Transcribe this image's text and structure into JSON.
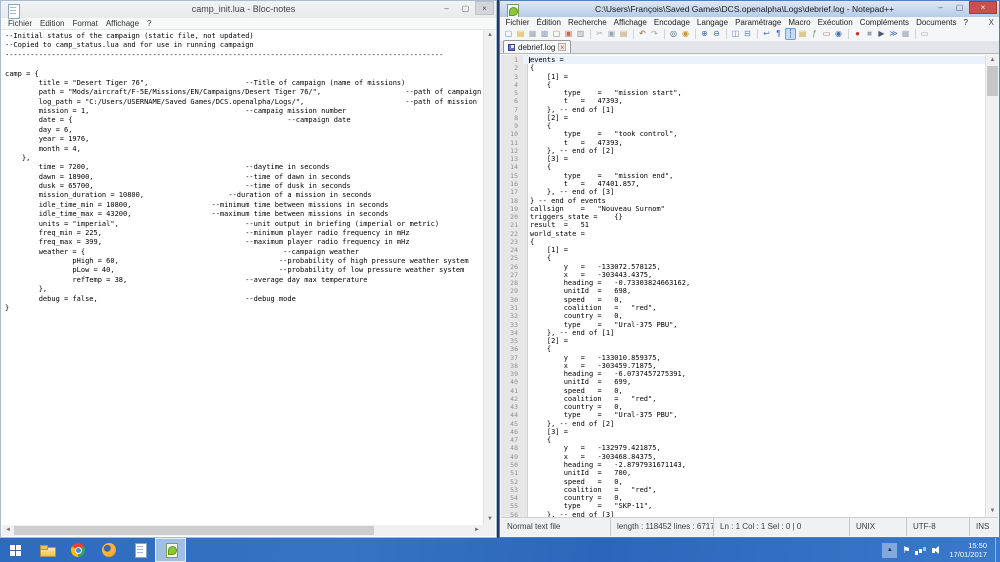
{
  "notepad": {
    "title": "camp_init.lua - Bloc-notes",
    "menu": [
      "Fichier",
      "Edition",
      "Format",
      "Affichage",
      "?"
    ],
    "window_buttons": {
      "minimize": "–",
      "maximize": "▢",
      "close": "×"
    },
    "lines": [
      "--Initial status of the campaign (static file, not updated)",
      "--Copied to camp_status.lua and for use in running campaign",
      "--------------------------------------------------------------------------------------------------------",
      "",
      "camp = {",
      "        title = \"Desert Tiger 76\",                       --Title of campaign (name of missions)",
      "        path = \"Mods/aircraft/F-5E/Missions/EN/Campaigns/Desert Tiger 76/\",                    --path of campaign",
      "        log_path = \"C:/Users/USERNAME/Saved Games/DCS.openalpha/Logs/\",                        --path of mission",
      "        mission = 1,                                     --campaig mission number",
      "        date = {                                                   --campaign date",
      "        day = 6,",
      "        year = 1976,",
      "        month = 4,",
      "    },",
      "        time = 7200,                                     --daytime in seconds",
      "        dawn = 18900,                                    --time of dawn in seconds",
      "        dusk = 65700,                                    --time of dusk in seconds",
      "        mission_duration = 10800,                    --duration of a mission in seconds",
      "        idle_time_min = 10800,                   --minimum time between missions in seconds",
      "        idle_time_max = 43200,                   --maximum time between missions in seconds",
      "        units = \"imperial\",                              --unit output in briefing (imperial or metric)",
      "        freq_min = 225,                                  --minimum player radio frequency in mHz",
      "        freq_max = 399,                                  --maximum player radio frequency in mHz",
      "        weather = {                                               --campaign weather",
      "                pHigh = 60,                                      --probability of high pressure weather system",
      "                pLow = 40,                                       --probability of low pressure weather system",
      "                refTemp = 38,                            --average day max temperature",
      "        },",
      "        debug = false,                                   --debug mode",
      "}"
    ]
  },
  "npp": {
    "title": "C:\\Users\\François\\Saved Games\\DCS.openalpha\\Logs\\debrief.log - Notepad++",
    "menu": [
      "Fichier",
      "Édition",
      "Recherche",
      "Affichage",
      "Encodage",
      "Langage",
      "Paramétrage",
      "Macro",
      "Exécution",
      "Compléments",
      "Documents",
      "?"
    ],
    "menu_close_label": "X",
    "window_buttons": {
      "minimize": "–",
      "maximize": "▢",
      "close": "×"
    },
    "tab_label": "debrief.log",
    "tab_close": "×",
    "toolbar": [
      {
        "name": "new-file-icon",
        "glyph": "▢",
        "color": "#5b8ed6"
      },
      {
        "name": "open-folder-icon",
        "glyph": "▤",
        "color": "#d9a62e"
      },
      {
        "name": "save-icon",
        "glyph": "▦",
        "color": "#98a6b4"
      },
      {
        "name": "save-all-icon",
        "glyph": "▩",
        "color": "#98a6b4"
      },
      {
        "name": "close-doc-icon",
        "glyph": "▢",
        "color": "#bf6a5a"
      },
      {
        "name": "close-all-docs-icon",
        "glyph": "▣",
        "color": "#bf6a5a"
      },
      {
        "name": "print-icon",
        "glyph": "▥",
        "color": "#8a97a4"
      },
      {
        "name": "toolbar-separator",
        "sep": true,
        "interactable": "false"
      },
      {
        "name": "cut-icon",
        "glyph": "✂",
        "color": "#9aa6b1"
      },
      {
        "name": "copy-icon",
        "glyph": "▣",
        "color": "#9aa6b1"
      },
      {
        "name": "paste-icon",
        "glyph": "▤",
        "color": "#bd9a62"
      },
      {
        "name": "toolbar-separator",
        "sep": true,
        "interactable": "false"
      },
      {
        "name": "undo-icon",
        "glyph": "↶",
        "color": "#8a6d3b"
      },
      {
        "name": "redo-icon",
        "glyph": "↷",
        "color": "#9aa4ad"
      },
      {
        "name": "toolbar-separator",
        "sep": true,
        "interactable": "false"
      },
      {
        "name": "find-icon",
        "glyph": "◎",
        "color": "#3c5a80"
      },
      {
        "name": "replace-icon",
        "glyph": "◉",
        "color": "#c9971f"
      },
      {
        "name": "toolbar-separator",
        "sep": true,
        "interactable": "false"
      },
      {
        "name": "zoom-in-icon",
        "glyph": "⊕",
        "color": "#3f6fae"
      },
      {
        "name": "zoom-out-icon",
        "glyph": "⊖",
        "color": "#3f6fae"
      },
      {
        "name": "toolbar-separator",
        "sep": true,
        "interactable": "false"
      },
      {
        "name": "sync-vertical-icon",
        "glyph": "◫",
        "color": "#5b84b8"
      },
      {
        "name": "sync-horizontal-icon",
        "glyph": "⊟",
        "color": "#5b84b8"
      },
      {
        "name": "toolbar-separator",
        "sep": true,
        "interactable": "false"
      },
      {
        "name": "word-wrap-icon",
        "glyph": "↩",
        "color": "#4a78b0"
      },
      {
        "name": "show-all-characters-icon",
        "glyph": "¶",
        "color": "#2f5fc0"
      },
      {
        "name": "indent-guide-icon",
        "glyph": "┆",
        "color": "#2f5fc0",
        "active": true
      },
      {
        "name": "document-map-icon",
        "glyph": "▤",
        "color": "#c9a22e"
      },
      {
        "name": "function-list-icon",
        "glyph": "ƒ",
        "color": "#58a058"
      },
      {
        "name": "monitoring-icon",
        "glyph": "▭",
        "color": "#bf6a5a"
      },
      {
        "name": "view-eye-icon",
        "glyph": "◉",
        "color": "#3f6fae"
      },
      {
        "name": "toolbar-separator",
        "sep": true,
        "interactable": "false"
      },
      {
        "name": "record-macro-icon",
        "glyph": "●",
        "color": "#c03a34"
      },
      {
        "name": "stop-macro-icon",
        "glyph": "■",
        "color": "#9aa6b1"
      },
      {
        "name": "play-macro-icon",
        "glyph": "▶",
        "color": "#4a5a6a"
      },
      {
        "name": "run-macro-multiple-icon",
        "glyph": "≫",
        "color": "#3f6fae"
      },
      {
        "name": "save-macro-icon",
        "glyph": "▦",
        "color": "#98a6b4"
      },
      {
        "name": "toolbar-separator",
        "sep": true,
        "interactable": "false"
      },
      {
        "name": "launch-icon",
        "glyph": "▭",
        "color": "#8a97a4"
      }
    ],
    "lines": [
      "events =",
      "{",
      "\t[1] =",
      "\t{",
      "\t\ttype\t=\t\"mission start\",",
      "\t\tt\t=\t47393,",
      "\t}, -- end of [1]",
      "\t[2] =",
      "\t{",
      "\t\ttype\t=\t\"took control\",",
      "\t\tt\t=\t47393,",
      "\t}, -- end of [2]",
      "\t[3] =",
      "\t{",
      "\t\ttype\t=\t\"mission end\",",
      "\t\tt\t=\t47401.857,",
      "\t}, -- end of [3]",
      "} -- end of events",
      "callsign\t=\t\"Nouveau Surnom\"",
      "triggers_state =\t{}",
      "result\t=\t51",
      "world_state =",
      "{",
      "\t[1] =",
      "\t{",
      "\t\ty\t=\t-133072.578125,",
      "\t\tx\t=\t-303443.4375,",
      "\t\theading =\t-0.73303824663162,",
      "\t\tunitId\t=\t698,",
      "\t\tspeed\t=\t0,",
      "\t\tcoalition\t=\t\"red\",",
      "\t\tcountry =\t0,",
      "\t\ttype\t=\t\"Ural-375 PBU\",",
      "\t}, -- end of [1]",
      "\t[2] =",
      "\t{",
      "\t\ty\t=\t-133010.859375,",
      "\t\tx\t=\t-303459.71875,",
      "\t\theading =\t-6.0737457275391,",
      "\t\tunitId\t=\t699,",
      "\t\tspeed\t=\t0,",
      "\t\tcoalition\t=\t\"red\",",
      "\t\tcountry =\t0,",
      "\t\ttype\t=\t\"Ural-375 PBU\",",
      "\t}, -- end of [2]",
      "\t[3] =",
      "\t{",
      "\t\ty\t=\t-132979.421875,",
      "\t\tx\t=\t-303468.84375,",
      "\t\theading =\t-2.8797931671143,",
      "\t\tunitId\t=\t700,",
      "\t\tspeed\t=\t0,",
      "\t\tcoalition\t=\t\"red\",",
      "\t\tcountry =\t0,",
      "\t\ttype\t=\t\"SKP-11\",",
      "\t}, -- end of [3]"
    ],
    "status": {
      "doc_type": "Normal text file",
      "length_info": "length : 118452    lines : 6717",
      "cursor_info": "Ln : 1    Col : 1    Sel : 0 | 0",
      "eol": "UNIX",
      "encoding": "UTF-8",
      "typing_mode": "INS"
    }
  },
  "taskbar": {
    "apps": [
      {
        "name": "start-button",
        "icon": "start"
      },
      {
        "name": "file-explorer-button",
        "icon": "explorer"
      },
      {
        "name": "chrome-button",
        "icon": "chrome"
      },
      {
        "name": "firefox-button",
        "icon": "firefox"
      },
      {
        "name": "notepad-button",
        "icon": "notepad"
      },
      {
        "name": "notepad-plus-plus-button",
        "icon": "npp",
        "active": true
      }
    ],
    "tray": {
      "hidden_icons_glyph": "▲",
      "time": "15:50",
      "date": "17/01/2017"
    }
  },
  "colors": {
    "taskbar_blue": "#2f6fc1",
    "active_close_red": "#c75050",
    "npp_green": "#8dc63f",
    "titlebar_active": "#b4cbe8"
  }
}
